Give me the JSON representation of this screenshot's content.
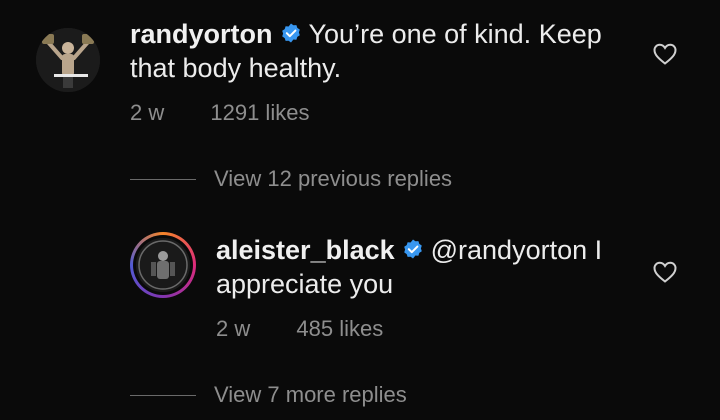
{
  "comments": [
    {
      "username": "randyorton",
      "text": "You’re one of kind. Keep that body healthy.",
      "time": "2 w",
      "likes": "1291 likes",
      "verified": true
    },
    {
      "username": "aleister_black",
      "mention": "@randyorton",
      "text": " I appreciate you",
      "time": "2 w",
      "likes": "485 likes",
      "verified": true
    }
  ],
  "view_previous_replies": "View 12 previous replies",
  "view_more_replies": "View 7 more replies",
  "colors": {
    "background": "#0a0a0a",
    "text": "#ececec",
    "muted": "#8e8e8e",
    "verified_badge": "#3897f0"
  },
  "icons": [
    "verified-badge-icon",
    "heart-icon"
  ]
}
